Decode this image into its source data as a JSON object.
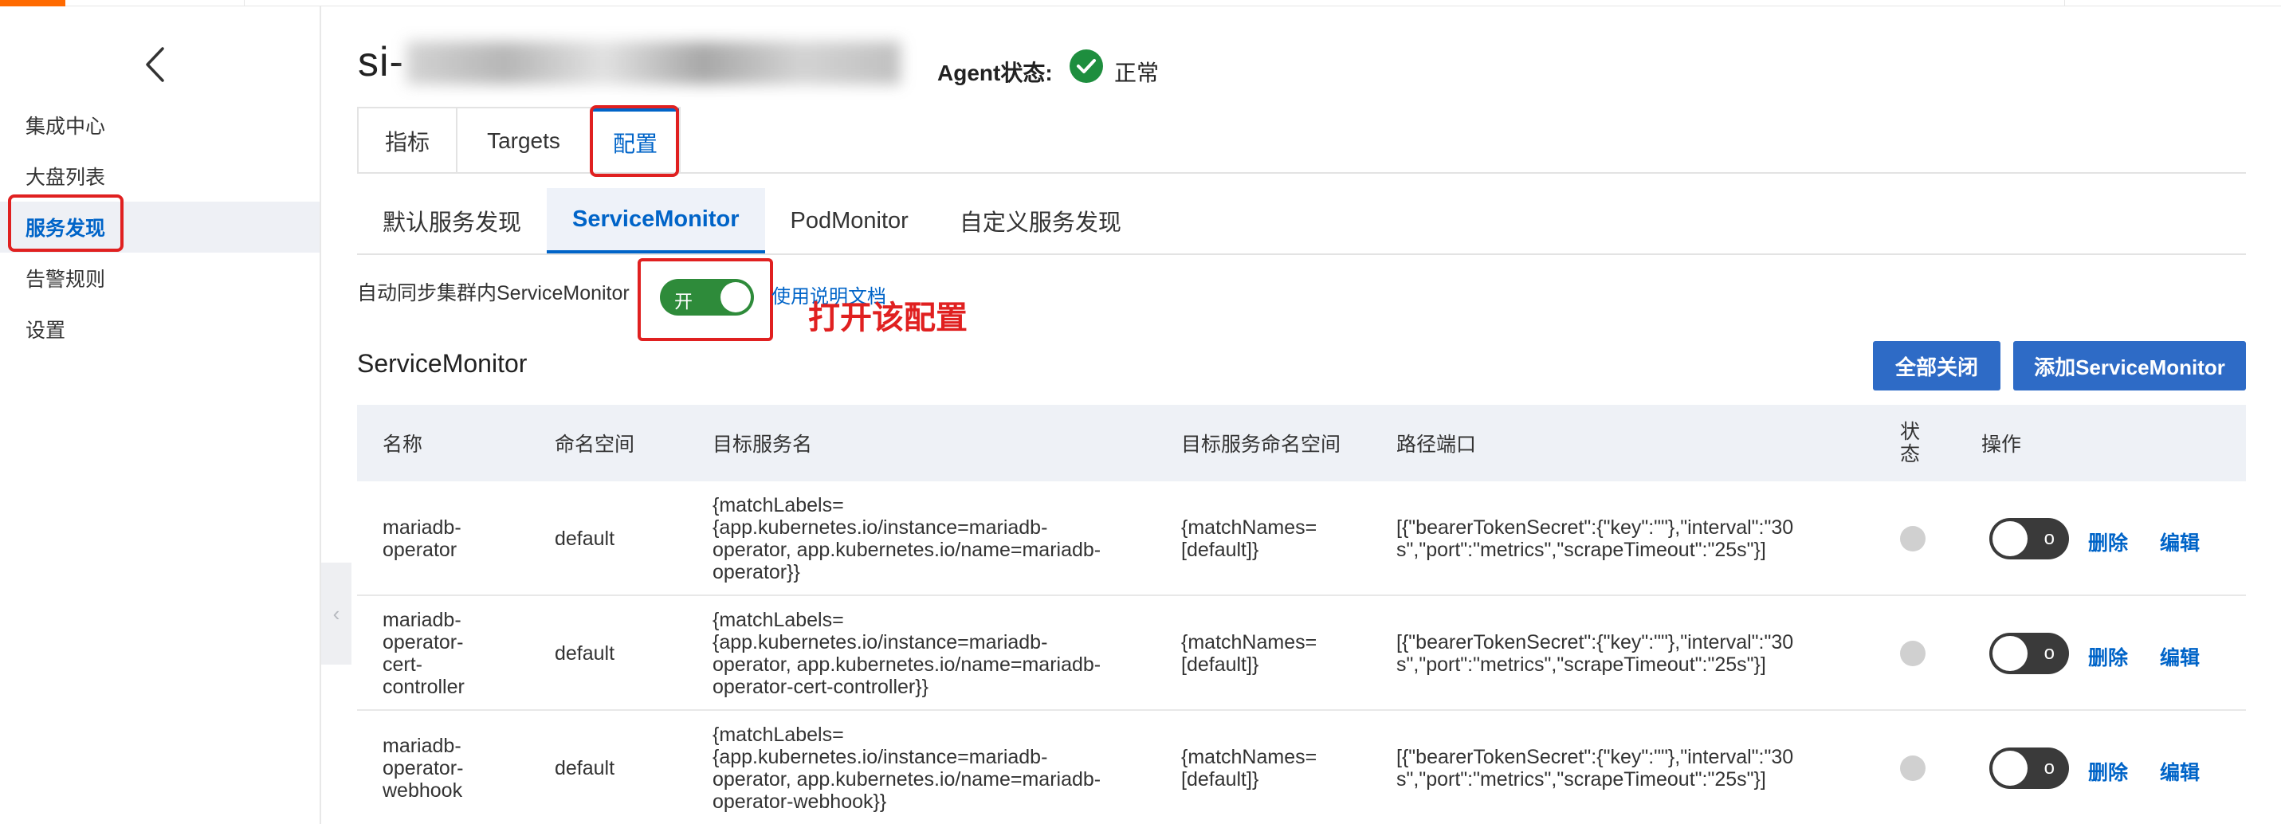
{
  "sidebar": {
    "items": [
      {
        "label": "集成中心"
      },
      {
        "label": "大盘列表"
      },
      {
        "label": "服务发现"
      },
      {
        "label": "告警规则"
      },
      {
        "label": "设置"
      }
    ]
  },
  "header": {
    "title": "si-",
    "agent_label": "Agent状态:",
    "agent_status": "正常"
  },
  "tabs_top": [
    "指标",
    "Targets",
    "配置"
  ],
  "tabs_sub": [
    "默认服务发现",
    "ServiceMonitor",
    "PodMonitor",
    "自定义服务发现"
  ],
  "sync": {
    "label": "自动同步集群内ServiceMonitor",
    "switch_text": "开",
    "doc_link": "使用说明文档",
    "annotation": "打开该配置"
  },
  "section": {
    "title": "ServiceMonitor",
    "close_all": "全部关闭",
    "add": "添加ServiceMonitor"
  },
  "table": {
    "headers": [
      "名称",
      "命名空间",
      "目标服务名",
      "目标服务命名空间",
      "路径端口",
      "状\n态",
      "操作"
    ],
    "rows": [
      {
        "name": "mariadb-\noperator",
        "namespace": "default",
        "target": "{matchLabels=\n{app.kubernetes.io/instance=mariadb-\noperator, app.kubernetes.io/name=mariadb-\noperator}}",
        "target_ns": "{matchNames=\n[default]}",
        "port": "[{\"bearerTokenSecret\":{\"key\":\"\"},\"interval\":\"30\ns\",\"port\":\"metrics\",\"scrapeTimeout\":\"25s\"}]",
        "switch_text": "o",
        "delete": "删除",
        "edit": "编辑"
      },
      {
        "name": "mariadb-\noperator-\ncert-\ncontroller",
        "namespace": "default",
        "target": "{matchLabels=\n{app.kubernetes.io/instance=mariadb-\noperator, app.kubernetes.io/name=mariadb-\noperator-cert-controller}}",
        "target_ns": "{matchNames=\n[default]}",
        "port": "[{\"bearerTokenSecret\":{\"key\":\"\"},\"interval\":\"30\ns\",\"port\":\"metrics\",\"scrapeTimeout\":\"25s\"}]",
        "switch_text": "o",
        "delete": "删除",
        "edit": "编辑"
      },
      {
        "name": "mariadb-\noperator-\nwebhook",
        "namespace": "default",
        "target": "{matchLabels=\n{app.kubernetes.io/instance=mariadb-\noperator, app.kubernetes.io/name=mariadb-\noperator-webhook}}",
        "target_ns": "{matchNames=\n[default]}",
        "port": "[{\"bearerTokenSecret\":{\"key\":\"\"},\"interval\":\"30\ns\",\"port\":\"metrics\",\"scrapeTimeout\":\"25s\"}]",
        "switch_text": "o",
        "delete": "删除",
        "edit": "编辑"
      }
    ]
  }
}
